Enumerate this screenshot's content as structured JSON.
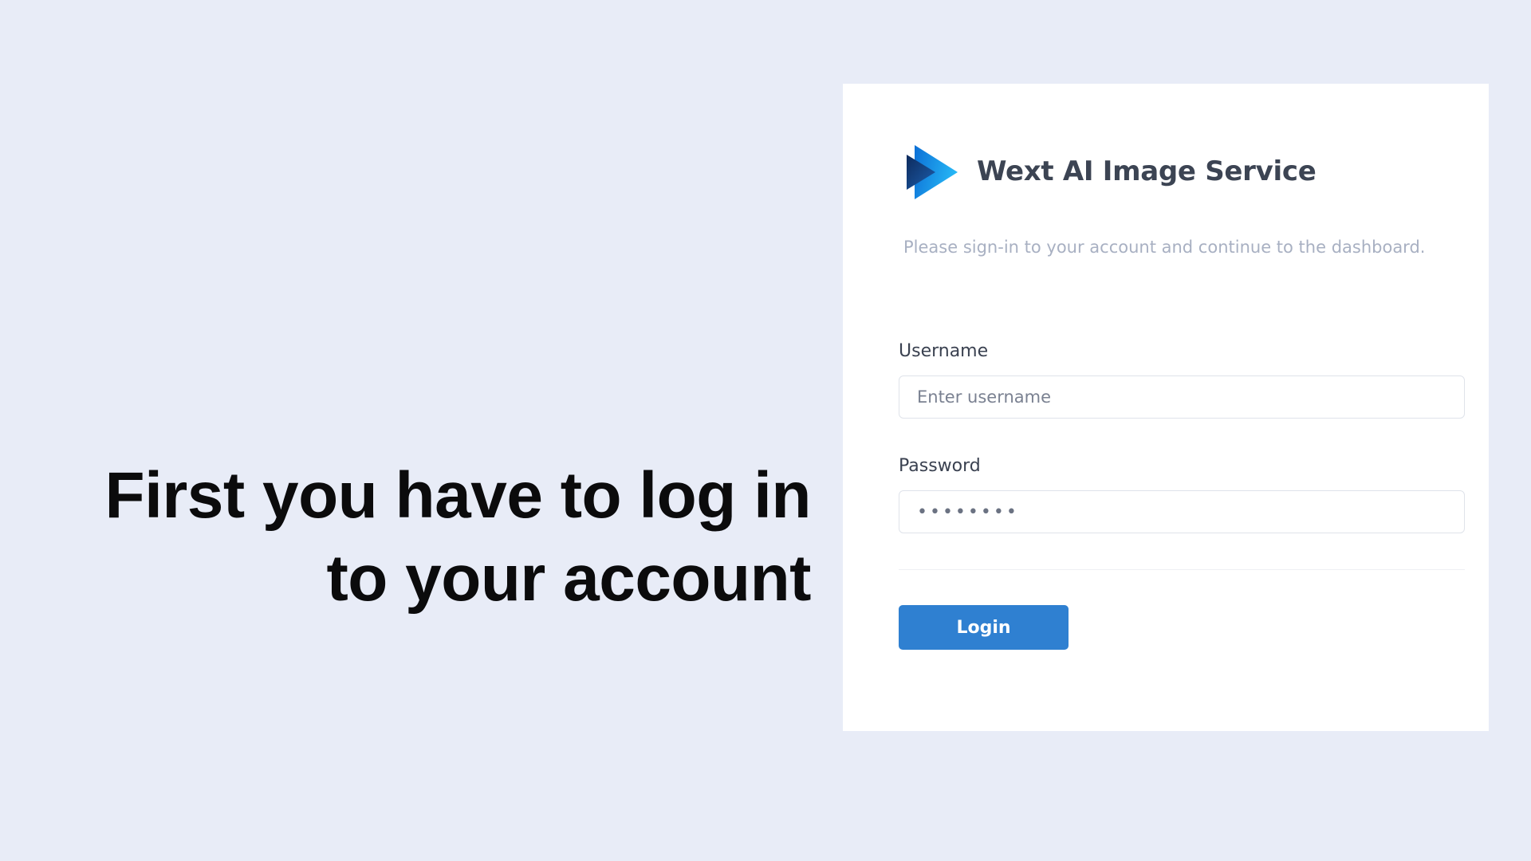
{
  "headline": {
    "line1": "First you have to log in",
    "line2": "to your account"
  },
  "login_card": {
    "brand_name": "Wext AI Image Service",
    "brand_icon": "play-triangle-logo",
    "subtitle": "Please sign-in to your account and continue to the dashboard.",
    "username": {
      "label": "Username",
      "placeholder": "Enter username",
      "value": ""
    },
    "password": {
      "label": "Password",
      "value": "••••••••"
    },
    "login_label": "Login"
  },
  "colors": {
    "background": "#e8ecf7",
    "card": "#ffffff",
    "accent": "#2f80d1",
    "logo_dark": "#1a3f7a",
    "logo_light": "#1fa0ee"
  }
}
